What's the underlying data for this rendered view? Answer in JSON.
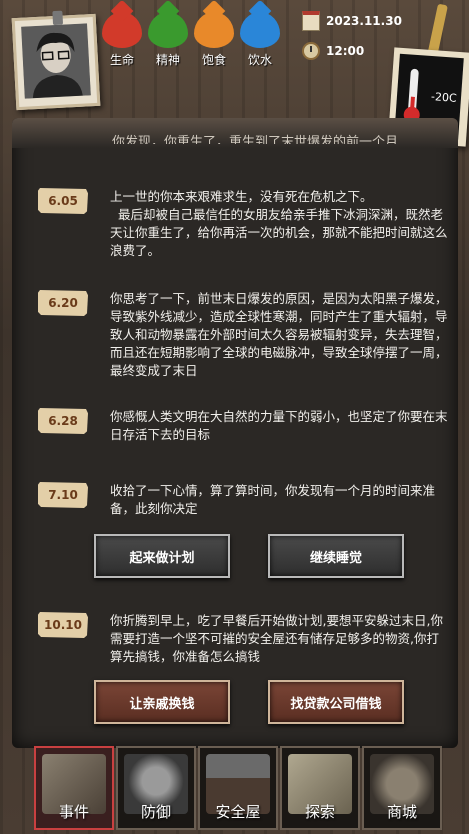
{
  "status": {
    "stats": [
      {
        "label": "生命",
        "icon": "life-drop-icon",
        "color": "#d23a2a"
      },
      {
        "label": "精神",
        "icon": "spirit-drop-icon",
        "color": "#3a9a2e"
      },
      {
        "label": "饱食",
        "icon": "food-drop-icon",
        "color": "#e8892a"
      },
      {
        "label": "饮水",
        "icon": "water-drop-icon",
        "color": "#2a86d8"
      }
    ],
    "date": "2023.11.30",
    "time": "12:00",
    "temperature": "-20C"
  },
  "log": {
    "cut_text": "你发现，你重生了，重生到了末世爆发的前一个月",
    "entries": [
      {
        "date": "6.05",
        "text": "上一世的你本来艰难求生，没有死在危机之下。\n  最后却被自己最信任的女朋友给亲手推下冰洞深渊，既然老天让你重生了，给你再活一次的机会，那就不能把时间就这么浪费了。"
      },
      {
        "date": "6.20",
        "text": "你思考了一下，前世末日爆发的原因，是因为太阳黑子爆发，导致紫外线减少，造成全球性寒潮，同时产生了重大辐射，导致人和动物暴露在外部时间太久容易被辐射变异，失去理智，而且还在短期影响了全球的电磁脉冲，导致全球停摆了一周，最终变成了末日"
      },
      {
        "date": "6.28",
        "text": "你感慨人类文明在大自然的力量下的弱小，也坚定了你要在末日存活下去的目标"
      },
      {
        "date": "7.10",
        "text": "收拾了一下心情，算了算时间，你发现有一个月的时间来准备，此刻你决定"
      },
      {
        "date": "10.10",
        "text": "你折腾到早上，吃了早餐后开始做计划,要想平安躲过末日,你需要打造一个坚不可摧的安全屋还有储存足够多的物资,你打算先搞钱，你准备怎么搞钱"
      }
    ],
    "choices_1": [
      "起来做计划",
      "继续睡觉"
    ],
    "choices_2": [
      "让亲戚换钱",
      "找贷款公司借钱"
    ]
  },
  "nav": [
    {
      "label": "事件",
      "icon": "event-book-icon"
    },
    {
      "label": "防御",
      "icon": "defense-helmet-icon"
    },
    {
      "label": "安全屋",
      "icon": "safehouse-icon"
    },
    {
      "label": "探索",
      "icon": "explore-map-icon"
    },
    {
      "label": "商城",
      "icon": "shop-backpack-icon"
    }
  ]
}
